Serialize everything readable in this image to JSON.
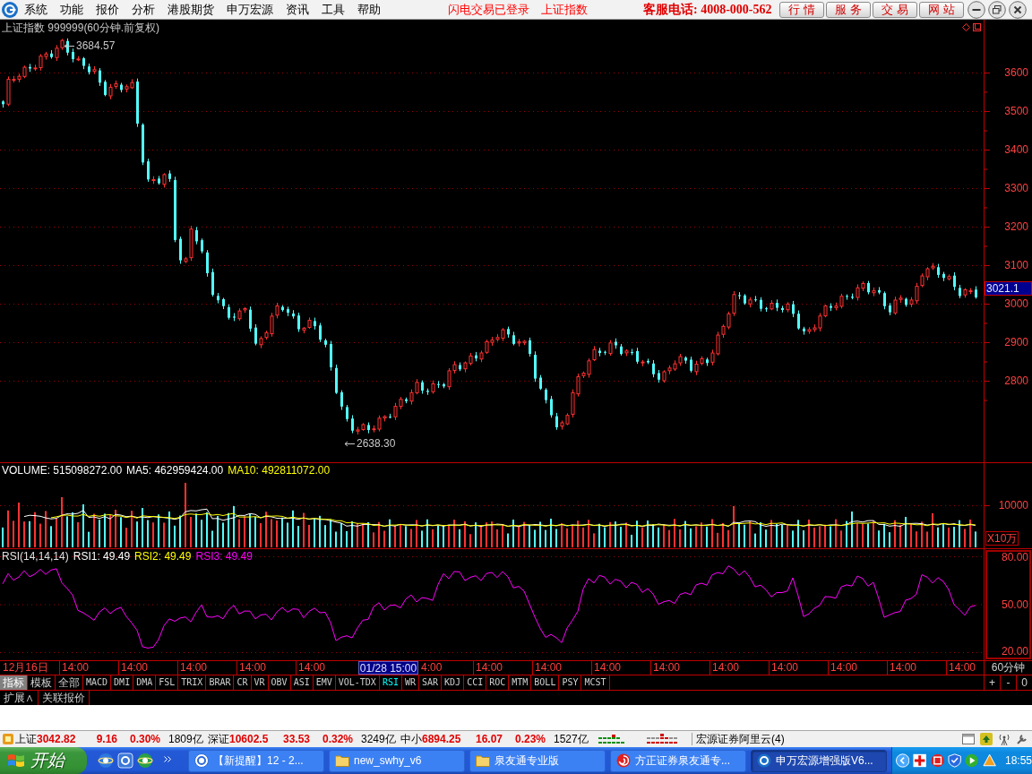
{
  "menu_bar": {
    "items": [
      "系统",
      "功能",
      "报价",
      "分析",
      "港股期货",
      "申万宏源",
      "资讯",
      "工具",
      "帮助"
    ],
    "notices": [
      "闪电交易已登录",
      "上证指数"
    ],
    "hotline": "客服电话: 4008-000-562",
    "buttons": [
      "行 情",
      "服 务",
      "交 易",
      "网 站"
    ]
  },
  "price_panel": {
    "title": "上证指数 999999(60分钟.前复权)",
    "high_label": "3684.57",
    "low_label": "2638.30",
    "axis_labels": [
      "3600",
      "3500",
      "3400",
      "3300",
      "3200",
      "3100",
      "3000",
      "2900",
      "2800"
    ],
    "current_price": "3021.1"
  },
  "volume_panel": {
    "readings": [
      {
        "text": "VOLUME: 515098272.00",
        "color": "#ffffff"
      },
      {
        "text": "MA5: 462959424.00",
        "color": "#ffffff"
      },
      {
        "text": "MA10: 492811072.00",
        "color": "#ffff00"
      }
    ],
    "axis_label": "10000",
    "unit": "X10万"
  },
  "rsi_panel": {
    "title": "RSI(14,14,14)",
    "readings": [
      {
        "text": "RSI1: 49.49",
        "color": "#ffffff"
      },
      {
        "text": "RSI2: 49.49",
        "color": "#ffff00"
      },
      {
        "text": "RSI3: 49.49",
        "color": "#ff00ff"
      }
    ],
    "axis_labels": [
      "80.00",
      "50.00",
      "20.00"
    ]
  },
  "time_axis": {
    "labels": [
      {
        "kind": "date",
        "text": "12月16日"
      },
      {
        "kind": "time",
        "text": "14:00"
      },
      {
        "kind": "time",
        "text": "14:00"
      },
      {
        "kind": "time",
        "text": "14:00"
      },
      {
        "kind": "time",
        "text": "14:00"
      },
      {
        "kind": "time",
        "text": "14:00"
      },
      {
        "kind": "cursor",
        "text": "01/28 15:00"
      },
      {
        "kind": "partial",
        "text": "4:00"
      },
      {
        "kind": "time",
        "text": "14:00"
      },
      {
        "kind": "time",
        "text": "14:00"
      },
      {
        "kind": "time",
        "text": "14:00"
      },
      {
        "kind": "time",
        "text": "14:00"
      },
      {
        "kind": "time",
        "text": "14:00"
      },
      {
        "kind": "time",
        "text": "14:00"
      },
      {
        "kind": "time",
        "text": "14:00"
      },
      {
        "kind": "time",
        "text": "14:00"
      },
      {
        "kind": "time",
        "text": "14:00"
      }
    ],
    "period": "60分钟"
  },
  "indicator_bar": {
    "modes": [
      {
        "label": "指标",
        "selected": true
      },
      {
        "label": "模板",
        "selected": false
      },
      {
        "label": "全部",
        "selected": false
      }
    ],
    "indicators": [
      {
        "label": "MACD",
        "selected": false
      },
      {
        "label": "DMI",
        "selected": false
      },
      {
        "label": "DMA",
        "selected": false
      },
      {
        "label": "FSL",
        "selected": false
      },
      {
        "label": "TRIX",
        "selected": false
      },
      {
        "label": "BRAR",
        "selected": false
      },
      {
        "label": "CR",
        "selected": false
      },
      {
        "label": "VR",
        "selected": false
      },
      {
        "label": "OBV",
        "selected": false
      },
      {
        "label": "ASI",
        "selected": false
      },
      {
        "label": "EMV",
        "selected": false
      },
      {
        "label": "VOL-TDX",
        "selected": false
      },
      {
        "label": "RSI",
        "selected": true
      },
      {
        "label": "WR",
        "selected": false
      },
      {
        "label": "SAR",
        "selected": false
      },
      {
        "label": "KDJ",
        "selected": false
      },
      {
        "label": "CCI",
        "selected": false
      },
      {
        "label": "ROC",
        "selected": false
      },
      {
        "label": "MTM",
        "selected": false
      },
      {
        "label": "BOLL",
        "selected": false
      },
      {
        "label": "PSY",
        "selected": false
      },
      {
        "label": "MCST",
        "selected": false
      }
    ],
    "zoom_buttons": [
      "+",
      "-",
      "0"
    ]
  },
  "extension_bar": {
    "tabs": [
      "扩展∧",
      "关联报价"
    ]
  },
  "status_bar": {
    "indices": [
      {
        "name": "上证",
        "value": "3042.82",
        "change": "9.16",
        "percent": "0.30%",
        "amount": "1809亿"
      },
      {
        "name": "深证",
        "value": "10602.5",
        "change": "33.53",
        "percent": "0.32%",
        "amount": "3249亿"
      },
      {
        "name": "中小",
        "value": "6894.25",
        "change": "16.07",
        "percent": "0.23%",
        "amount": "1527亿"
      }
    ],
    "broker": "宏源证券阿里云(4)"
  },
  "taskbar": {
    "start": "开始",
    "windows": [
      {
        "title": "【新提醒】12 - 2...",
        "selected": false
      },
      {
        "title": "new_swhy_v6",
        "selected": false
      },
      {
        "title": "泉友通专业版",
        "selected": false
      },
      {
        "title": "方正证券泉友通专...",
        "selected": false
      },
      {
        "title": "申万宏源增强版V6...",
        "selected": true
      }
    ],
    "clock": "18:55"
  }
}
